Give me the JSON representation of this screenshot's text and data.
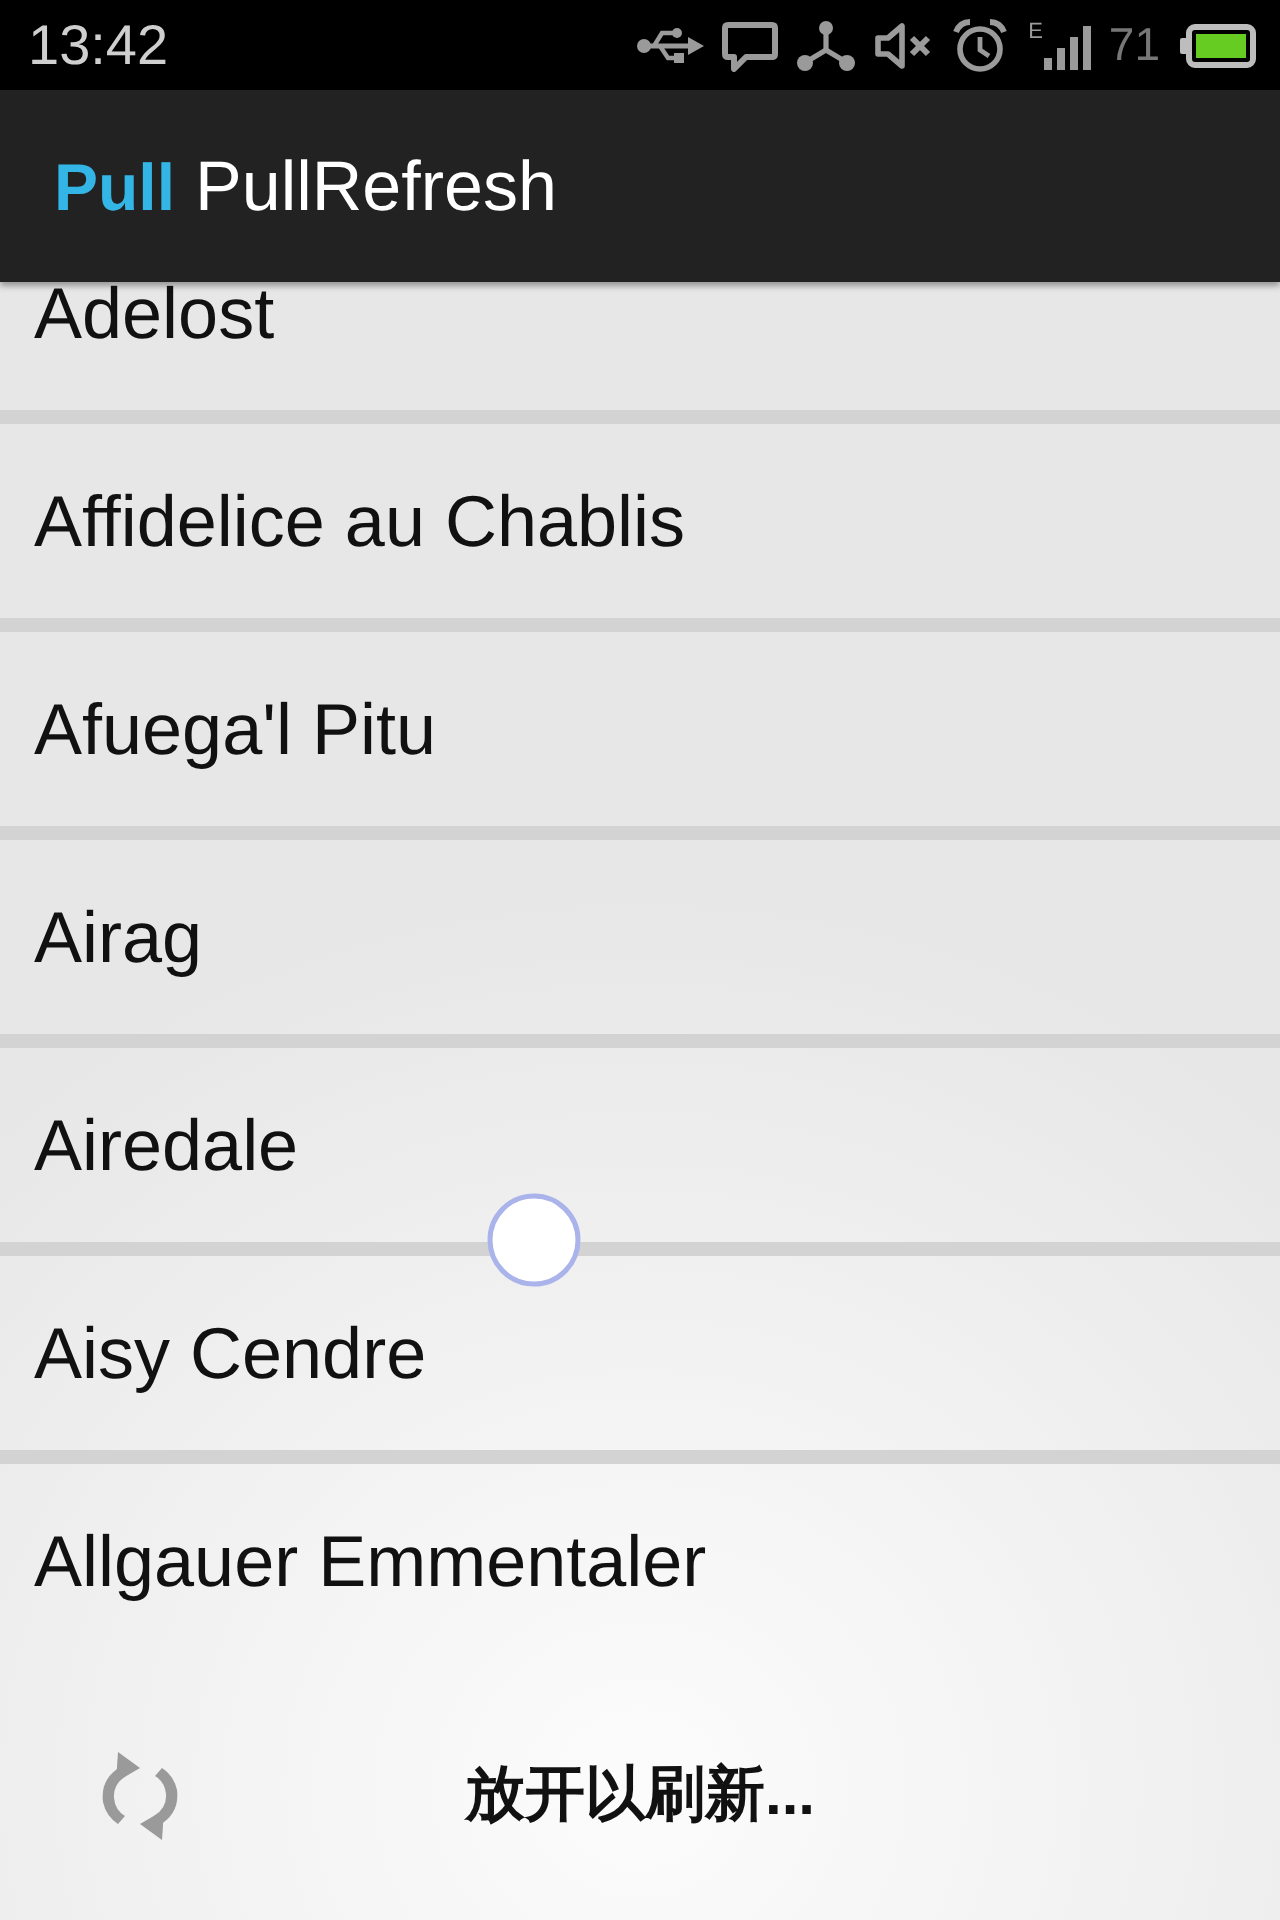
{
  "status_bar": {
    "time": "13:42",
    "network_type": "E",
    "battery_percent": "71"
  },
  "app_bar": {
    "logo": "Pull",
    "title": "PullRefresh"
  },
  "list": {
    "items": [
      "Adelost",
      "Affidelice au Chablis",
      "Afuega'l Pitu",
      "Airag",
      "Airedale",
      "Aisy Cendre",
      "Allgauer Emmentaler"
    ]
  },
  "refresh_footer": {
    "message": "放开以刷新..."
  }
}
